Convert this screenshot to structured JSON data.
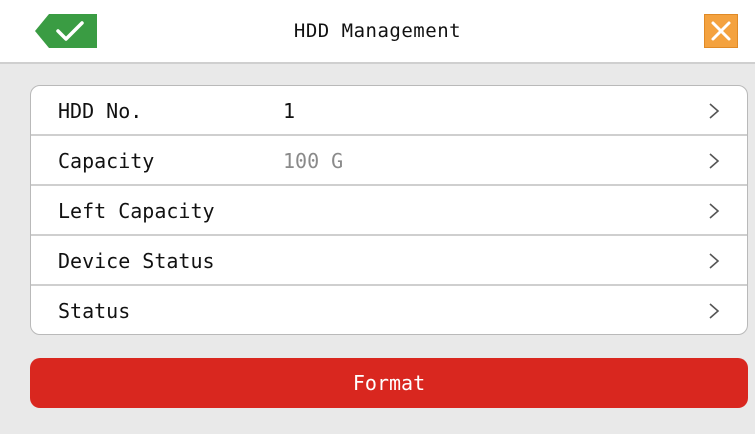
{
  "header": {
    "title": "HDD Management",
    "confirm_icon": "checkmark-icon",
    "close_icon": "close-icon"
  },
  "rows": [
    {
      "label": "HDD No.",
      "value": "1",
      "muted": false
    },
    {
      "label": "Capacity",
      "value": "100 G",
      "muted": true
    },
    {
      "label": "Left Capacity",
      "value": "",
      "muted": false
    },
    {
      "label": "Device Status",
      "value": "",
      "muted": false
    },
    {
      "label": "Status",
      "value": "",
      "muted": false
    }
  ],
  "format_button": {
    "label": "Format"
  },
  "colors": {
    "accent_green": "#3a9c43",
    "close_orange": "#f4a23f",
    "format_red": "#d9271f"
  }
}
